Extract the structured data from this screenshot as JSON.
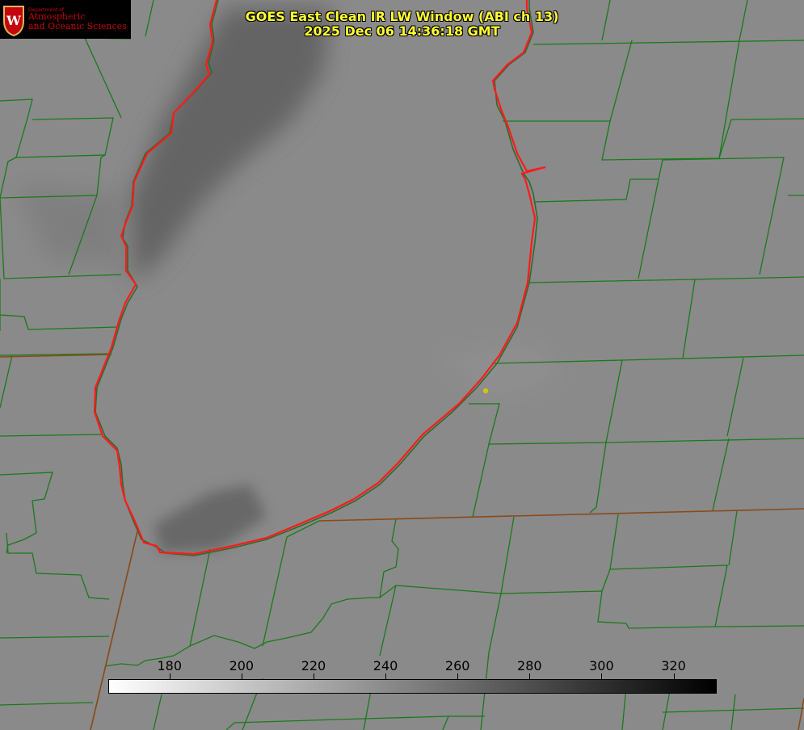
{
  "title": {
    "line1": "GOES East Clean IR LW Window (ABI ch 13)",
    "line2": "2025 Dec 06 14:36:18 GMT"
  },
  "logo": {
    "department": "Department of",
    "line1": "Atmospheric",
    "line2": "and Oceanic Sciences",
    "seal_letter": "W"
  },
  "colorbar": {
    "ticks": [
      "180",
      "200",
      "220",
      "240",
      "260",
      "280",
      "300",
      "320"
    ],
    "range": [
      163,
      332
    ],
    "gradient": [
      "#ffffff",
      "#000000"
    ]
  },
  "colors": {
    "background": "#8a8a8a",
    "lake_outline": "#ff1a1a",
    "county_lines": "#1a7a1a",
    "title_text": "#ffff33",
    "marker": "#d4c21a"
  }
}
